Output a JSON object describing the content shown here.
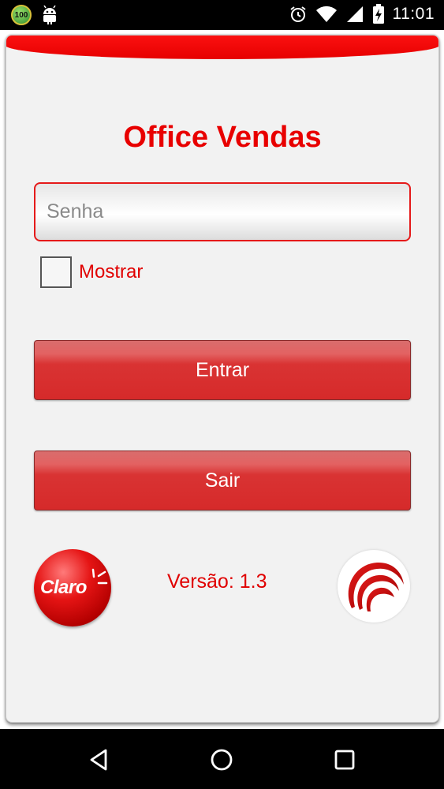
{
  "status_bar": {
    "battery_badge": "100",
    "time": "11:01",
    "icons": [
      "battery-badge-icon",
      "android-icon",
      "alarm-icon",
      "wifi-icon",
      "signal-icon",
      "battery-charging-icon"
    ]
  },
  "app": {
    "title": "Office Vendas",
    "password_placeholder": "Senha",
    "show_password_label": "Mostrar",
    "show_password_checked": false,
    "enter_button_label": "Entrar",
    "exit_button_label": "Sair",
    "version_text": "Versão: 1.3",
    "claro_logo_text": "Claro"
  },
  "colors": {
    "accent_red": "#e80000",
    "button_red": "#d62a2a",
    "card_background": "#f2f2f2"
  },
  "nav_bar": {
    "icons": [
      "back-icon",
      "home-icon",
      "recents-icon"
    ]
  }
}
